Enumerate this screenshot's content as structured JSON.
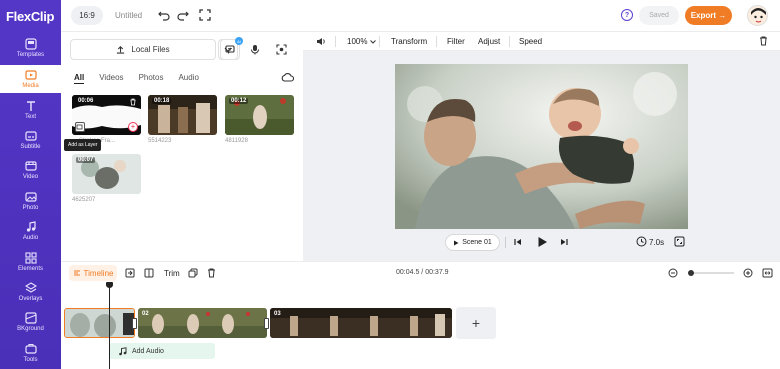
{
  "app": {
    "logo": "FlexClip"
  },
  "sidebar": {
    "items": [
      {
        "label": "Templates",
        "icon": "templates-icon",
        "active": false
      },
      {
        "label": "Media",
        "icon": "media-icon",
        "active": true
      },
      {
        "label": "Text",
        "icon": "text-icon",
        "active": false
      },
      {
        "label": "Subtitle",
        "icon": "subtitle-icon",
        "active": false
      },
      {
        "label": "Video",
        "icon": "video-icon",
        "active": false
      },
      {
        "label": "Photo",
        "icon": "photo-icon",
        "active": false
      },
      {
        "label": "Audio",
        "icon": "audio-icon",
        "active": false
      },
      {
        "label": "Elements",
        "icon": "elements-icon",
        "active": false
      },
      {
        "label": "Overlays",
        "icon": "overlays-icon",
        "active": false
      },
      {
        "label": "BKground",
        "icon": "background-icon",
        "active": false
      },
      {
        "label": "Tools",
        "icon": "tools-icon",
        "active": false
      }
    ]
  },
  "topbar": {
    "ratio": "16:9",
    "title": "Untitled",
    "help": "?",
    "saved": "Saved",
    "export": "Export →"
  },
  "media": {
    "upload_label": "Local Files",
    "badge": "AI",
    "tabs": [
      {
        "label": "All",
        "active": true
      },
      {
        "label": "Videos",
        "active": false
      },
      {
        "label": "Photos",
        "active": false
      },
      {
        "label": "Audio",
        "active": false
      }
    ],
    "items": [
      {
        "duration": "00:06",
        "caption": "...-Strokes Fra..."
      },
      {
        "duration": "00:18",
        "caption": "5514223"
      },
      {
        "duration": "00:12",
        "caption": "4811928"
      },
      {
        "duration": "00:07",
        "caption": "4625207"
      }
    ],
    "tooltip": "Add as Layer"
  },
  "preview": {
    "zoom": "100%",
    "tools": [
      "Transform",
      "Filter",
      "Adjust",
      "Speed"
    ],
    "scene_label": "Scene 01",
    "duration": "7.0s"
  },
  "timeline": {
    "tab_label": "Timeline",
    "trim_label": "Trim",
    "time": "00:04.5 / 00:37.9",
    "clips": [
      {
        "num": ""
      },
      {
        "num": "02"
      },
      {
        "num": "03"
      }
    ],
    "add_audio": "Add Audio"
  },
  "colors": {
    "sidebar": "#5537c7",
    "accent": "#f07c25",
    "audio_track": "#e4f6ee"
  }
}
